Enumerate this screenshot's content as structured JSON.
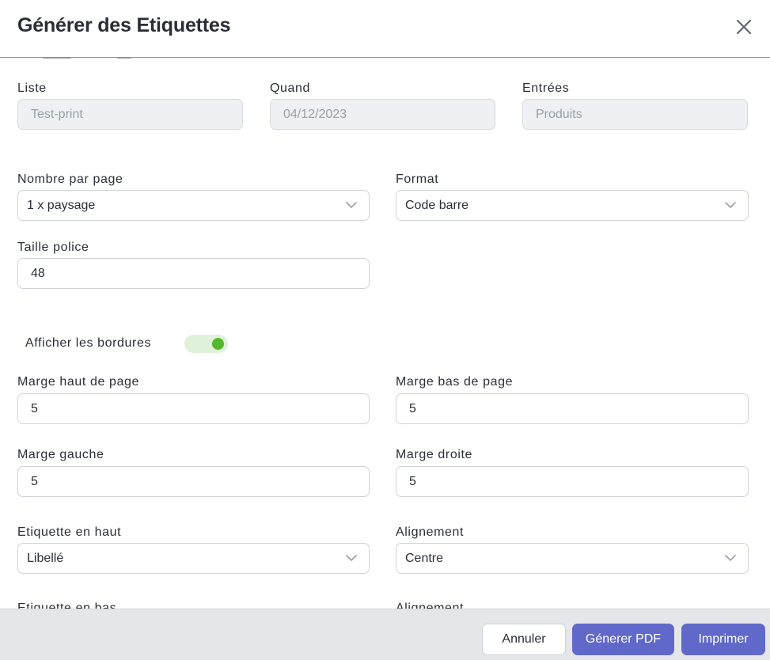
{
  "dialog": {
    "title": "Générer des Etiquettes"
  },
  "info": {
    "liste": {
      "label": "Liste",
      "value": "Test-print"
    },
    "quand": {
      "label": "Quand",
      "value": "04/12/2023"
    },
    "entrees": {
      "label": "Entrées",
      "value": "Produits"
    }
  },
  "settings": {
    "nombre_par_page": {
      "label": "Nombre par page",
      "value": "1 x paysage"
    },
    "format": {
      "label": "Format",
      "value": "Code barre"
    },
    "taille_police": {
      "label": "Taille police",
      "value": "48"
    },
    "afficher_bordures": {
      "label": "Afficher les bordures",
      "checked": true
    },
    "marge_haut": {
      "label": "Marge haut de page",
      "value": "5"
    },
    "marge_bas": {
      "label": "Marge bas de page",
      "value": "5"
    },
    "marge_gauche": {
      "label": "Marge gauche",
      "value": "5"
    },
    "marge_droite": {
      "label": "Marge droite",
      "value": "5"
    },
    "etiquette_haut": {
      "label": "Etiquette en haut",
      "value": "Libellé"
    },
    "alignement_haut": {
      "label": "Alignement",
      "value": "Centre"
    },
    "etiquette_bas": {
      "label": "Etiquette en bas"
    },
    "alignement_bas": {
      "label": "Alignement"
    }
  },
  "footer": {
    "cancel_label": "Annuler",
    "pdf_label": "Génerer PDF",
    "print_label": "Imprimer"
  },
  "colors": {
    "primary": "#6069c9",
    "toggle_on": "#55b72c",
    "toggle_track": "#e0f1d9",
    "footer_bg": "#e4e6ea"
  }
}
